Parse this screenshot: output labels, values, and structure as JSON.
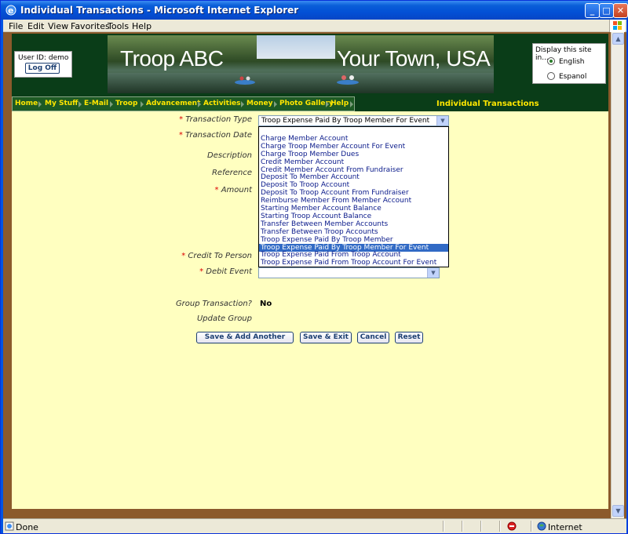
{
  "window": {
    "title": "Individual Transactions - Microsoft Internet Explorer",
    "menu": [
      "File",
      "Edit",
      "View",
      "Favorites",
      "Tools",
      "Help"
    ]
  },
  "header": {
    "user_label": "User ID:  demo",
    "logoff_label": "Log Off",
    "banner_left": "Troop ABC",
    "banner_right": "Your Town, USA",
    "language": {
      "prompt": "Display this site in...",
      "options": [
        "English",
        "Espanol"
      ],
      "selected": "English"
    }
  },
  "nav": {
    "items": [
      "Home",
      "My Stuff",
      "E-Mail",
      "Troop",
      "Advancement",
      "Activities",
      "Money",
      "Photo Gallery",
      "Help"
    ],
    "page_title": "Individual Transactions"
  },
  "form": {
    "required_mark": "*",
    "transaction_type_label": "Transaction Type",
    "transaction_type_value": "Troop Expense Paid By Troop Member For Event",
    "transaction_date_label": "Transaction Date",
    "description_label": "Description",
    "reference_label": "Reference",
    "amount_label": "Amount",
    "credit_to_person_label": "Credit To Person",
    "debit_event_label": "Debit Event",
    "group_transaction_label": "Group Transaction?",
    "group_transaction_value": "No",
    "update_group_label": "Update Group",
    "dropdown_options": [
      "",
      "Charge Member Account",
      "Charge Troop Member Account For Event",
      "Charge Troop Member Dues",
      "Credit Member Account",
      "Credit Member Account From Fundraiser",
      "Deposit To Member Account",
      "Deposit To Troop Account",
      "Deposit To Troop Account From Fundraiser",
      "Reimburse Member From Member Account",
      "Starting Member Account Balance",
      "Starting Troop Account Balance",
      "Transfer Between Member Accounts",
      "Transfer Between Troop Accounts",
      "Troop Expense Paid By Troop Member",
      "Troop Expense Paid By Troop Member For Event",
      "Troop Expense Paid From Troop Account",
      "Troop Expense Paid From Troop Account For Event"
    ],
    "selected_index": 15
  },
  "buttons": {
    "save_add": "Save & Add Another",
    "save_exit": "Save & Exit",
    "cancel": "Cancel",
    "reset": "Reset"
  },
  "status": {
    "text": "Done",
    "zone": "Internet"
  },
  "colors": {
    "page_bg": "#ffffc0",
    "nav_text": "#ffe600",
    "header_bg": "#0a3d18",
    "highlight": "#316ac5"
  }
}
